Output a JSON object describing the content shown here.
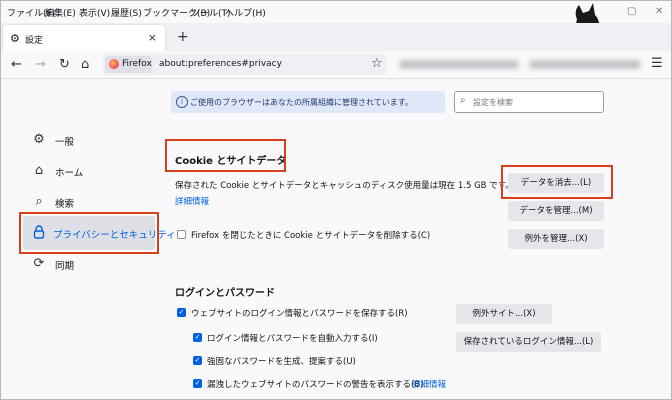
{
  "menubar": [
    "ファイル(F)",
    "編集(E)",
    "表示(V)",
    "履歴(S)",
    "ブックマーク(B)",
    "ツール(T)",
    "ヘルプ(H)"
  ],
  "tab": {
    "title": "設定",
    "close": "×"
  },
  "new_tab": "+",
  "urlbar": {
    "identity": "Firefox",
    "url": "about:preferences#privacy"
  },
  "notice": {
    "icon": "i",
    "text": "ご使用のブラウザーはあなたの所属組織に管理されています。"
  },
  "search": {
    "placeholder": "設定を検索"
  },
  "sidebar": [
    {
      "label": "一般",
      "icon": "gear-icon"
    },
    {
      "label": "ホーム",
      "icon": "home-icon"
    },
    {
      "label": "検索",
      "icon": "search-icon"
    },
    {
      "label": "プライバシーとセキュリティ",
      "icon": "lock-icon",
      "selected": true
    },
    {
      "label": "同期",
      "icon": "sync-icon"
    }
  ],
  "cookie": {
    "heading": "Cookie とサイトデータ",
    "desc": "保存された Cookie とサイトデータとキャッシュのディスク使用量は現在 1.5 GB です。",
    "learn_more": "詳細情報",
    "clear_button": "データを消去...(L)",
    "manage_button": "データを管理...(M)",
    "exceptions_button": "例外を管理...(X)",
    "delete_on_close": "Firefox を閉じたときに Cookie とサイトデータを削除する(C)",
    "delete_on_close_checked": false
  },
  "logins": {
    "heading": "ログインとパスワード",
    "save_logins": "ウェブサイトのログイン情報とパスワードを保存する(R)",
    "autofill": "ログイン情報とパスワードを自動入力する(I)",
    "suggest": "強固なパスワードを生成、提案する(U)",
    "breach": "漏洩したウェブサイトのパスワードの警告を表示する(B)",
    "breach_link": "詳細情報",
    "exceptions_button": "例外サイト...(X)",
    "saved_logins_button": "保存されているログイン情報...(L)"
  },
  "colors": {
    "accent": "#0061e0",
    "highlight": "#d9401a"
  }
}
